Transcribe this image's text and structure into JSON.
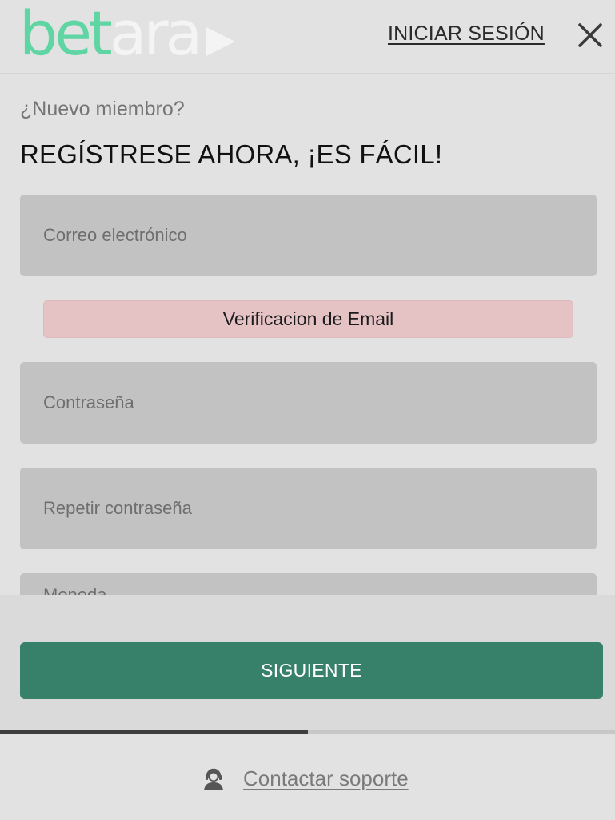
{
  "header": {
    "logo_part1": "bet",
    "logo_part2": "ara",
    "login_label": "INICIAR SESIÓN",
    "close_icon": "close-icon"
  },
  "form": {
    "subtitle": "¿Nuevo miembro?",
    "title": "REGÍSTRESE AHORA, ¡ES FÁCIL!",
    "email_placeholder": "Correo electrónico",
    "verify_label": "Verificacion de Email",
    "password_placeholder": "Contraseña",
    "repeat_password_placeholder": "Repetir contraseña",
    "next_field_partial": "Moneda"
  },
  "footer": {
    "next_label": "SIGUIENTE",
    "progress_fraction": 0.5,
    "support_label": "Contactar soporte",
    "support_icon": "support-agent-icon"
  },
  "colors": {
    "brand_green": "#5fd5a4",
    "button_green": "#37806a",
    "verify_pink": "#e5c3c5",
    "field_gray": "#c2c2c2"
  }
}
